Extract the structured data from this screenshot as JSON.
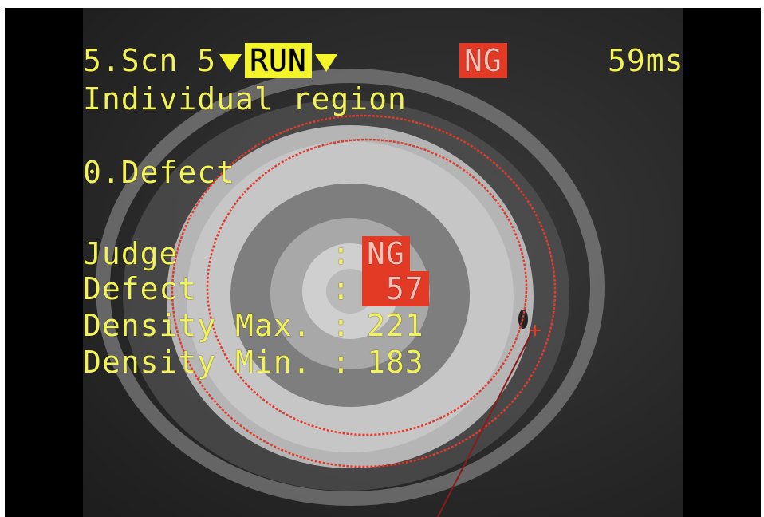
{
  "header": {
    "scene": "5.Scn 5",
    "mode": "RUN",
    "result": "NG",
    "time": "59ms"
  },
  "region_title": "Individual region",
  "item": "0.Defect",
  "measurements": [
    {
      "label": "Judge",
      "value": "NG",
      "highlight": true
    },
    {
      "label": "Defect",
      "value": " 57",
      "highlight": true
    },
    {
      "label": "Density Max.",
      "value": "221",
      "highlight": false
    },
    {
      "label": "Density Min.",
      "value": "183",
      "highlight": false
    }
  ],
  "colors": {
    "osd_text": "#f2f25a",
    "highlight_yellow": "#f4f42a",
    "ng_red": "#e33a25",
    "region_circle": "#e23a2a"
  },
  "icons": [
    "dropdown-triangle-icon",
    "crosshair-icon"
  ]
}
